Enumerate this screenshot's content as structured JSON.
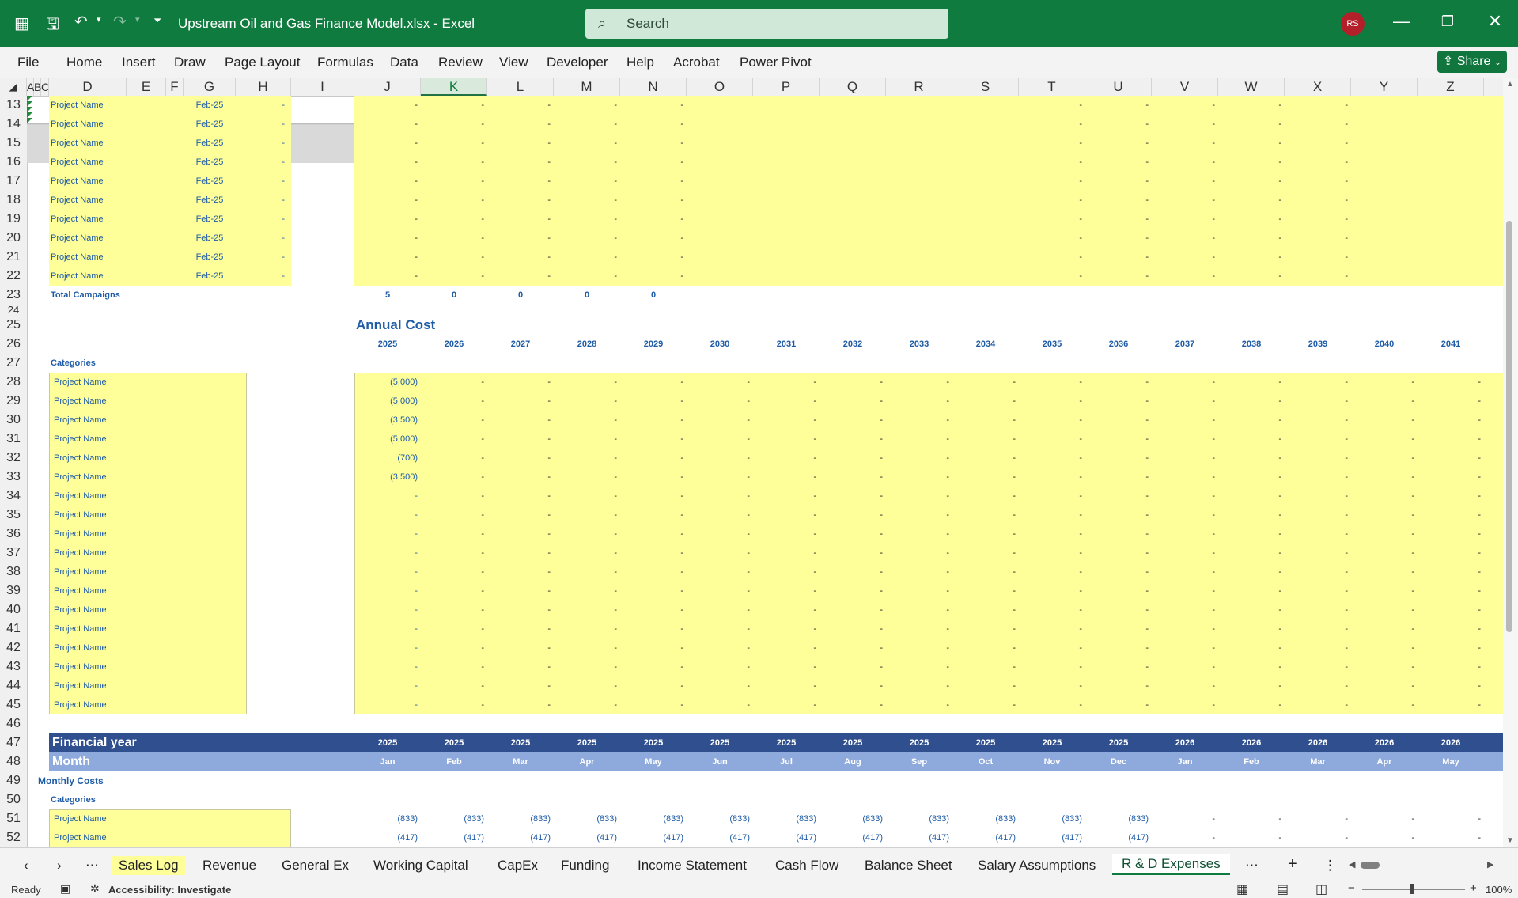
{
  "window": {
    "title": "Upstream Oil and Gas Finance Model.xlsx  -  Excel",
    "search_placeholder": "Search",
    "user_initials": "RS"
  },
  "ribbon": {
    "tabs": [
      "File",
      "Home",
      "Insert",
      "Draw",
      "Page Layout",
      "Formulas",
      "Data",
      "Review",
      "View",
      "Developer",
      "Help",
      "Acrobat",
      "Power Pivot"
    ],
    "share_label": "Share"
  },
  "columns": [
    "A",
    "B",
    "C",
    "D",
    "E",
    "F",
    "G",
    "H",
    "I",
    "J",
    "K",
    "L",
    "M",
    "N",
    "O",
    "P",
    "Q",
    "R",
    "S",
    "T",
    "U",
    "V",
    "W",
    "X",
    "Y",
    "Z"
  ],
  "selected_column": "K",
  "rows": [
    "13",
    "14",
    "15",
    "16",
    "17",
    "18",
    "19",
    "20",
    "21",
    "22",
    "23",
    "24",
    "25",
    "26",
    "27",
    "28",
    "29",
    "30",
    "31",
    "32",
    "33",
    "34",
    "35",
    "36",
    "37",
    "38",
    "39",
    "40",
    "41",
    "42",
    "43",
    "44",
    "45",
    "46",
    "47",
    "48",
    "49",
    "50",
    "51",
    "52"
  ],
  "sheet": {
    "project_name": "Project Name",
    "project_date": "Feb-25",
    "dash": "-",
    "total_campaigns_label": "Total Campaigns",
    "total_campaigns_values": [
      "5",
      "0",
      "0",
      "0",
      "0"
    ],
    "annual_cost_title": "Annual Cost",
    "years": [
      "2025",
      "2026",
      "2027",
      "2028",
      "2029",
      "2030",
      "2031",
      "2032",
      "2033",
      "2034",
      "2035",
      "2036",
      "2037",
      "2038",
      "2039",
      "2040",
      "2041"
    ],
    "categories_label": "Categories",
    "annual_costs_2025": [
      "(5,000)",
      "(5,000)",
      "(3,500)",
      "(5,000)",
      "(700)",
      "(3,500)",
      "-",
      "-",
      "-",
      "-",
      "-",
      "-",
      "-",
      "-",
      "-",
      "-",
      "-",
      "-"
    ],
    "financial_year_label": "Financial year",
    "financial_years": [
      "2025",
      "2025",
      "2025",
      "2025",
      "2025",
      "2025",
      "2025",
      "2025",
      "2025",
      "2025",
      "2025",
      "2025",
      "2026",
      "2026",
      "2026",
      "2026",
      "2026"
    ],
    "month_label": "Month",
    "months": [
      "Jan",
      "Feb",
      "Mar",
      "Apr",
      "May",
      "Jun",
      "Jul",
      "Aug",
      "Sep",
      "Oct",
      "Nov",
      "Dec",
      "Jan",
      "Feb",
      "Mar",
      "Apr",
      "May"
    ],
    "monthly_costs_label": "Monthly Costs",
    "monthly_row_51": [
      "(833)",
      "(833)",
      "(833)",
      "(833)",
      "(833)",
      "(833)",
      "(833)",
      "(833)",
      "(833)",
      "(833)",
      "(833)",
      "(833)",
      "-",
      "-",
      "-",
      "-",
      "-"
    ],
    "monthly_row_52": [
      "(417)",
      "(417)",
      "(417)",
      "(417)",
      "(417)",
      "(417)",
      "(417)",
      "(417)",
      "(417)",
      "(417)",
      "(417)",
      "(417)",
      "-",
      "-",
      "-",
      "-",
      "-"
    ]
  },
  "sheet_tabs": [
    "Sales Log",
    "Revenue",
    "General Ex",
    "Working Capital",
    "CapEx",
    "Funding",
    "Income Statement",
    "Cash Flow",
    "Balance Sheet",
    "Salary Assumptions",
    "R & D Expenses"
  ],
  "active_sheet": "R & D Expenses",
  "status": {
    "ready": "Ready",
    "accessibility": "Accessibility: Investigate",
    "zoom": "100%"
  }
}
